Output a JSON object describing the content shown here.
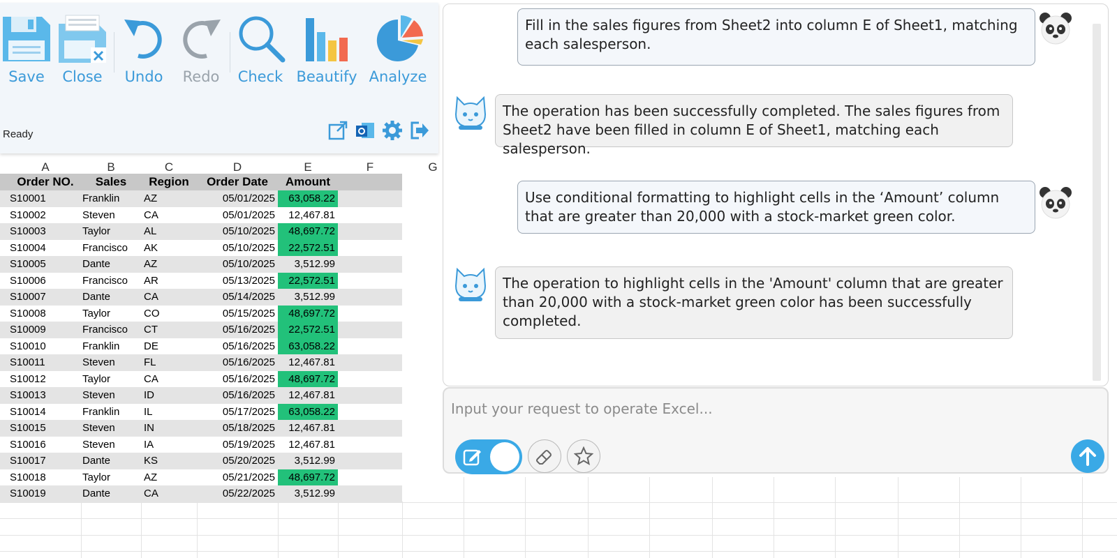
{
  "toolbar": {
    "buttons": [
      {
        "label": "Save",
        "icon": "save-icon"
      },
      {
        "label": "Close",
        "icon": "close-workbook-icon"
      },
      {
        "label": "Undo",
        "icon": "undo-icon"
      },
      {
        "label": "Redo",
        "icon": "redo-icon"
      },
      {
        "label": "Check",
        "icon": "magnifier-icon"
      },
      {
        "label": "Beautify",
        "icon": "bar-chart-icon"
      },
      {
        "label": "Analyze",
        "icon": "pie-chart-icon"
      }
    ],
    "status": "Ready",
    "small_icons": [
      "external-link-icon",
      "outlook-icon",
      "gear-icon",
      "logout-icon"
    ]
  },
  "sheet": {
    "columns": [
      "A",
      "B",
      "C",
      "D",
      "E",
      "F",
      "G"
    ],
    "headers": [
      "Order NO.",
      "Sales",
      "Region",
      "Order Date",
      "Amount"
    ],
    "rows": [
      {
        "order": "S10001",
        "sales": "Franklin",
        "region": "AZ",
        "date": "05/01/2025",
        "amount": "63,058.22",
        "highlight": true
      },
      {
        "order": "S10002",
        "sales": "Steven",
        "region": "CA",
        "date": "05/01/2025",
        "amount": "12,467.81",
        "highlight": false
      },
      {
        "order": "S10003",
        "sales": "Taylor",
        "region": "AL",
        "date": "05/10/2025",
        "amount": "48,697.72",
        "highlight": true
      },
      {
        "order": "S10004",
        "sales": "Francisco",
        "region": "AK",
        "date": "05/10/2025",
        "amount": "22,572.51",
        "highlight": true
      },
      {
        "order": "S10005",
        "sales": "Dante",
        "region": "AZ",
        "date": "05/10/2025",
        "amount": "3,512.99",
        "highlight": false
      },
      {
        "order": "S10006",
        "sales": "Francisco",
        "region": "AR",
        "date": "05/13/2025",
        "amount": "22,572.51",
        "highlight": true
      },
      {
        "order": "S10007",
        "sales": "Dante",
        "region": "CA",
        "date": "05/14/2025",
        "amount": "3,512.99",
        "highlight": false
      },
      {
        "order": "S10008",
        "sales": "Taylor",
        "region": "CO",
        "date": "05/15/2025",
        "amount": "48,697.72",
        "highlight": true
      },
      {
        "order": "S10009",
        "sales": "Francisco",
        "region": "CT",
        "date": "05/16/2025",
        "amount": "22,572.51",
        "highlight": true
      },
      {
        "order": "S10010",
        "sales": "Franklin",
        "region": "DE",
        "date": "05/16/2025",
        "amount": "63,058.22",
        "highlight": true
      },
      {
        "order": "S10011",
        "sales": "Steven",
        "region": "FL",
        "date": "05/16/2025",
        "amount": "12,467.81",
        "highlight": false
      },
      {
        "order": "S10012",
        "sales": "Taylor",
        "region": "CA",
        "date": "05/16/2025",
        "amount": "48,697.72",
        "highlight": true
      },
      {
        "order": "S10013",
        "sales": "Steven",
        "region": "ID",
        "date": "05/16/2025",
        "amount": "12,467.81",
        "highlight": false
      },
      {
        "order": "S10014",
        "sales": "Franklin",
        "region": "IL",
        "date": "05/17/2025",
        "amount": "63,058.22",
        "highlight": true
      },
      {
        "order": "S10015",
        "sales": "Steven",
        "region": "IN",
        "date": "05/18/2025",
        "amount": "12,467.81",
        "highlight": false
      },
      {
        "order": "S10016",
        "sales": "Steven",
        "region": "IA",
        "date": "05/19/2025",
        "amount": "12,467.81",
        "highlight": false
      },
      {
        "order": "S10017",
        "sales": "Dante",
        "region": "KS",
        "date": "05/20/2025",
        "amount": "3,512.99",
        "highlight": false
      },
      {
        "order": "S10018",
        "sales": "Taylor",
        "region": "AZ",
        "date": "05/21/2025",
        "amount": "48,697.72",
        "highlight": true
      },
      {
        "order": "S10019",
        "sales": "Dante",
        "region": "CA",
        "date": "05/22/2025",
        "amount": "3,512.99",
        "highlight": false
      }
    ],
    "highlight_color": "#22c17a",
    "header_color": "#c8c8c8",
    "stripe_color": "#e4e4e4"
  },
  "chat": {
    "messages": [
      {
        "role": "user",
        "text": "Fill in the sales figures from Sheet2 into column E of Sheet1, matching each salesperson."
      },
      {
        "role": "bot",
        "text": "The operation has been successfully completed. The sales figures from Sheet2 have been filled in column E of Sheet1, matching each salesperson."
      },
      {
        "role": "user",
        "text": "Use conditional formatting to highlight cells in the ‘Amount’ column that are greater than 20,000 with a stock-market green color."
      },
      {
        "role": "bot",
        "text": "The operation to highlight cells in the 'Amount' column that are greater than 20,000 with a stock-market green color has been successfully completed."
      }
    ],
    "input_placeholder": "Input your request to operate Excel...",
    "accent_color": "#3aa9e6"
  }
}
